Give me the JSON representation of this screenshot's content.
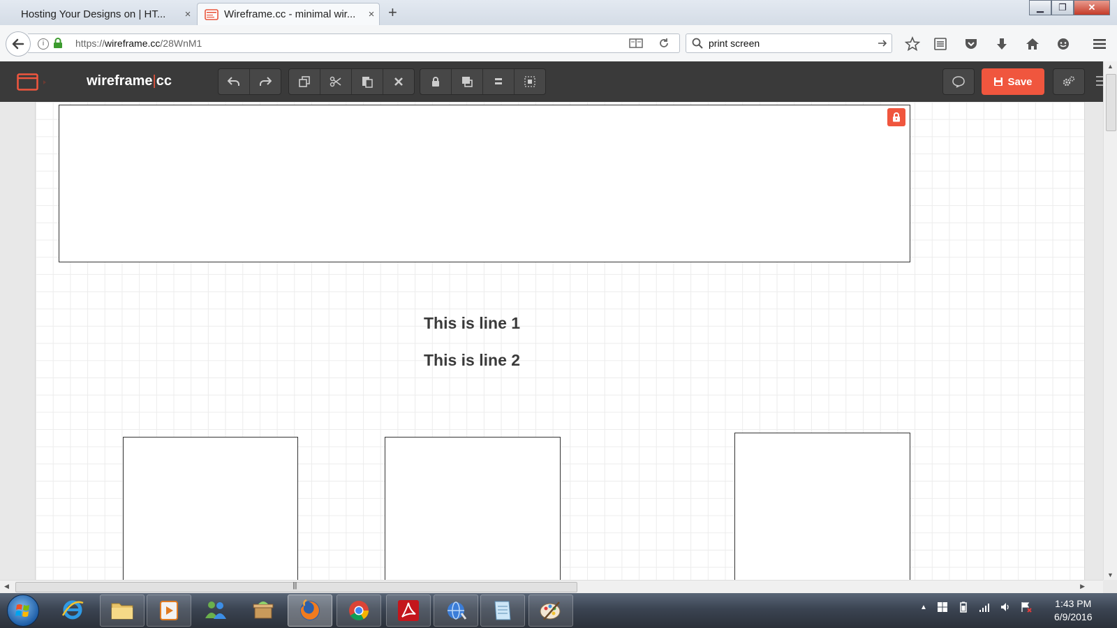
{
  "browser": {
    "tabs": [
      {
        "label": "Hosting Your Designs on | HT...",
        "close": "×"
      },
      {
        "label": "Wireframe.cc - minimal wir...",
        "close": "×"
      }
    ],
    "new_tab": "+",
    "window_controls": {
      "minimize": "▁",
      "restore": "❐",
      "close": "✕"
    },
    "url": {
      "scheme": "https://",
      "host": "wireframe.cc",
      "path": "/28WnM1"
    },
    "search_text": "print screen",
    "site_info": "i"
  },
  "app": {
    "logo_a": "wireframe",
    "logo_sep": "|",
    "logo_b": "cc",
    "save_label": "Save",
    "toolbar_groups": [
      [
        "undo-icon",
        "redo-icon"
      ],
      [
        "duplicate-icon",
        "cut-icon",
        "paste-icon",
        "delete-icon"
      ],
      [
        "lock-icon",
        "bring-to-front-icon",
        "align-icon",
        "group-icon"
      ]
    ]
  },
  "canvas": {
    "line1": "This is line 1",
    "line2": "This is line 2"
  },
  "scrollbar": {
    "grip": "|||"
  },
  "taskbar": {
    "apps": [
      "internet-explorer",
      "file-explorer",
      "media-player",
      "messenger",
      "archive-tool",
      "firefox",
      "chrome",
      "adobe-reader",
      "network-tool",
      "notepad",
      "paint"
    ],
    "active_app": "firefox",
    "time": "1:43 PM",
    "date": "6/9/2016"
  },
  "colors": {
    "accent": "#f0563e",
    "toolbar": "#3a3a3a",
    "canvas_text": "#3a3a3a"
  }
}
